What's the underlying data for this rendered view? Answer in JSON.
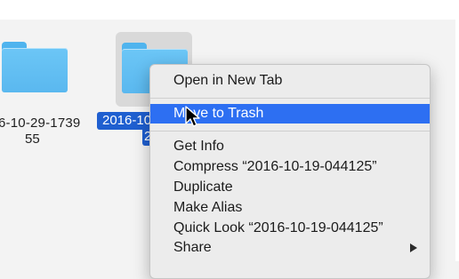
{
  "desktop": {
    "folders": [
      {
        "name_line1": "6-10-29-1739",
        "name_line2": "55",
        "icon": "folder-icon"
      },
      {
        "name_line1": "2016-10",
        "name_line2": "2",
        "icon": "folder-icon",
        "selected": true
      }
    ]
  },
  "context_menu": {
    "items": [
      {
        "label": "Open in New Tab"
      },
      {
        "label": "Move to Trash",
        "highlighted": true
      },
      {
        "label": "Get Info"
      },
      {
        "label": "Compress “2016-10-19-044125”"
      },
      {
        "label": "Duplicate"
      },
      {
        "label": "Make Alias"
      },
      {
        "label": "Quick Look “2016-10-19-044125”"
      },
      {
        "label": "Share",
        "icon": "chevron-right-icon"
      }
    ]
  },
  "colors": {
    "selection": "#2d6ff2",
    "label_selection": "#1f5fd0",
    "folder": "#5ab8ef"
  }
}
